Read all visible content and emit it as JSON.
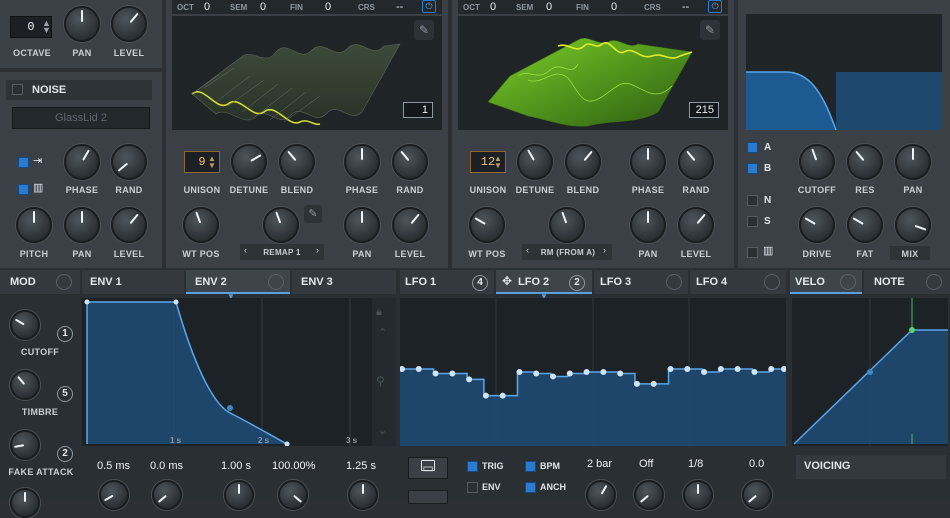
{
  "osc_a_header": {
    "oct_label": "OCT",
    "oct_val": "0",
    "sem_label": "SEM",
    "sem_val": "0",
    "fin_label": "FIN",
    "fin_val": "0",
    "crs_label": "CRS",
    "crs_val": "--"
  },
  "osc_b_header": {
    "oct_label": "OCT",
    "oct_val": "0",
    "sem_label": "SEM",
    "sem_val": "0",
    "fin_label": "FIN",
    "fin_val": "0",
    "crs_label": "CRS",
    "crs_val": "--"
  },
  "sub": {
    "octave_val": "0",
    "octave_label": "OCTAVE",
    "pan_label": "PAN",
    "level_label": "LEVEL"
  },
  "noise": {
    "title": "NOISE",
    "preset": "GlassLid 2",
    "phase_label": "PHASE",
    "rand_label": "RAND",
    "pitch_label": "PITCH",
    "pan_label": "PAN",
    "level_label": "LEVEL"
  },
  "osc_a": {
    "frame": "1",
    "unison_val": "9",
    "unison_label": "UNISON",
    "detune_label": "DETUNE",
    "blend_label": "BLEND",
    "phase_label": "PHASE",
    "rand_label": "RAND",
    "wtpos_label": "WT POS",
    "remap_label": "REMAP 1",
    "pan_label": "PAN",
    "level_label": "LEVEL"
  },
  "osc_b": {
    "frame": "215",
    "unison_val": "12",
    "unison_label": "UNISON",
    "detune_label": "DETUNE",
    "blend_label": "BLEND",
    "phase_label": "PHASE",
    "rand_label": "RAND",
    "wtpos_label": "WT POS",
    "rm_label": "RM (FROM A)",
    "pan_label": "PAN",
    "level_label": "LEVEL"
  },
  "filter": {
    "a_label": "A",
    "b_label": "B",
    "n_label": "N",
    "s_label": "S",
    "cutoff_label": "CUTOFF",
    "res_label": "RES",
    "pan_label": "PAN",
    "drive_label": "DRIVE",
    "fat_label": "FAT",
    "mix_label": "MIX"
  },
  "mod": {
    "title": "MOD",
    "cutoff_label": "CUTOFF",
    "cutoff_count": "1",
    "timbre_label": "TIMBRE",
    "timbre_count": "5",
    "fake_label": "FAKE ATTACK",
    "fake_count": "2"
  },
  "env_tabs": [
    "ENV 1",
    "ENV 2",
    "ENV 3"
  ],
  "env": {
    "t1": "1 s",
    "t2": "2 s",
    "t3": "3 s",
    "attack": "0.5 ms",
    "hold": "0.0 ms",
    "decay": "1.00 s",
    "sustain": "100.00%",
    "release": "1.25 s"
  },
  "lfo_tabs": [
    "LFO 1",
    "LFO 2",
    "LFO 3",
    "LFO 4"
  ],
  "lfo": {
    "lfo1_count": "4",
    "lfo2_count": "2",
    "trig": "TRIG",
    "env": "ENV",
    "bpm": "BPM",
    "anch": "ANCH",
    "rate": "2 bar",
    "off": "Off",
    "grid": "1/8",
    "smooth": "0.0"
  },
  "velo": {
    "velo_tab": "VELO",
    "note_tab": "NOTE",
    "voicing": "VOICING"
  },
  "chart_data": {
    "type": "line",
    "lfo_steps": [
      0.52,
      0.52,
      0.49,
      0.49,
      0.45,
      0.34,
      0.34,
      0.5,
      0.49,
      0.47,
      0.49,
      0.5,
      0.5,
      0.49,
      0.42,
      0.42,
      0.52,
      0.52,
      0.5,
      0.52,
      0.52,
      0.5,
      0.52
    ]
  }
}
